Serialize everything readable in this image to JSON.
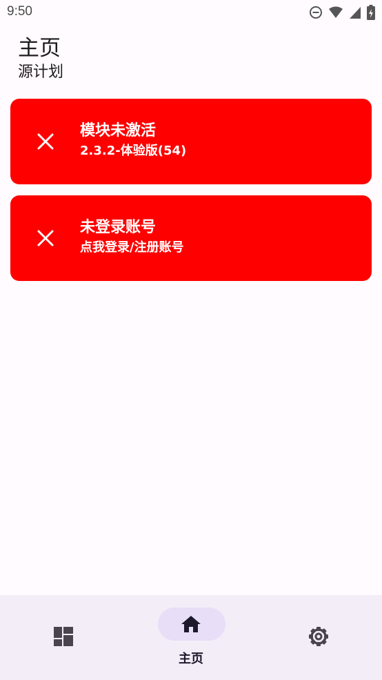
{
  "status_bar": {
    "time": "9:50",
    "icons": [
      "do-not-disturb-icon",
      "wifi-icon",
      "signal-icon",
      "battery-charging-icon"
    ]
  },
  "header": {
    "title": "主页",
    "subtitle": "源计划"
  },
  "cards": [
    {
      "icon": "close-icon",
      "title": "模块未激活",
      "subtitle": "2.3.2-体验版(54)",
      "color": "#ff0000"
    },
    {
      "icon": "close-icon",
      "title": "未登录账号",
      "subtitle": "点我登录/注册账号",
      "color": "#ff0000"
    }
  ],
  "bottom_nav": {
    "items": [
      {
        "icon": "dashboard-icon",
        "label": "",
        "selected": false
      },
      {
        "icon": "home-icon",
        "label": "主页",
        "selected": true
      },
      {
        "icon": "settings-icon",
        "label": "",
        "selected": false
      }
    ],
    "background": "#f3edf7",
    "indicator_color": "#e8def8"
  },
  "colors": {
    "background": "#fffbfe",
    "card_text": "#ffffff"
  }
}
